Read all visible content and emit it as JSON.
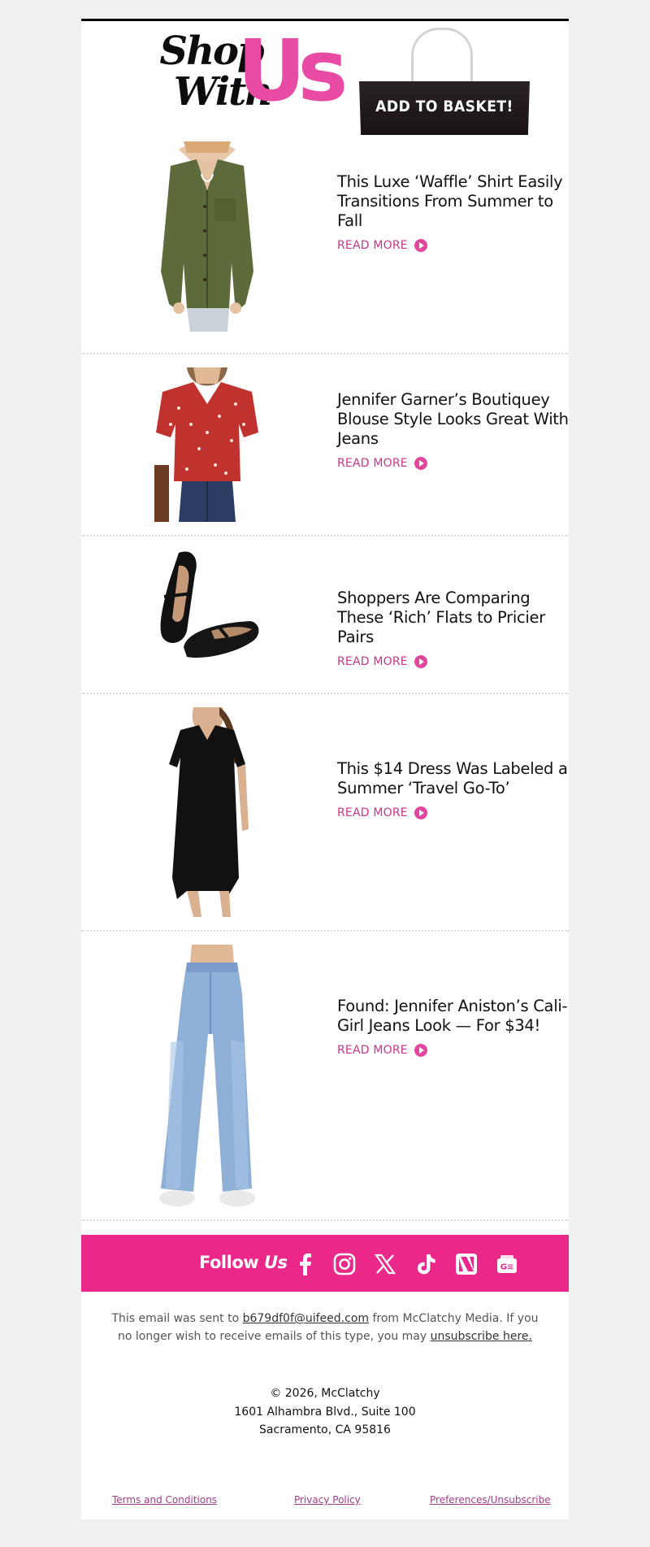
{
  "header": {
    "logo_line1": "Shop",
    "logo_line2": "With",
    "logo_brand": "Us",
    "basket_label": "ADD TO BASKET!"
  },
  "articles": [
    {
      "title": "This Luxe ‘Waffle’ Shirt Easily Transitions From Summer to Fall",
      "cta": "READ MORE",
      "image": "olive-waffle-shirt"
    },
    {
      "title": "Jennifer Garner’s Boutiquey Blouse Style Looks Great With Jeans",
      "cta": "READ MORE",
      "image": "red-floral-blouse"
    },
    {
      "title": "Shoppers Are Comparing These ‘Rich’ Flats to Pricier Pairs",
      "cta": "READ MORE",
      "image": "black-mary-jane-flats"
    },
    {
      "title": "This $14 Dress Was Labeled a Summer ‘Travel Go-To’",
      "cta": "READ MORE",
      "image": "black-tshirt-dress"
    },
    {
      "title": "Found: Jennifer Aniston’s Cali-Girl Jeans Look — For $34!",
      "cta": "READ MORE",
      "image": "light-wash-wide-leg-jeans"
    }
  ],
  "follow": {
    "label": "Follow",
    "brand": "Us",
    "icons": [
      "facebook-icon",
      "instagram-icon",
      "x-icon",
      "tiktok-icon",
      "apple-news-icon",
      "google-news-icon"
    ]
  },
  "footer": {
    "notice_prefix": "This email was sent to",
    "email": "b679df0f@uifeed.com",
    "notice_middle": "from McClatchy Media. If you no longer wish to receive emails of this type, you may",
    "unsubscribe": "unsubscribe here.",
    "copyright": "© 2026, McClatchy",
    "address_line1": "1601 Alhambra Blvd., Suite 100",
    "address_line2": "Sacramento, CA 95816",
    "links": [
      "Terms and Conditions",
      "Privacy Policy",
      "Preferences/Unsubscribe"
    ]
  },
  "colors": {
    "brand_pink": "#e9288a",
    "logo_pink": "#e84ba4",
    "link_pink": "#c7358a",
    "page_bg": "#f1f1f1"
  }
}
